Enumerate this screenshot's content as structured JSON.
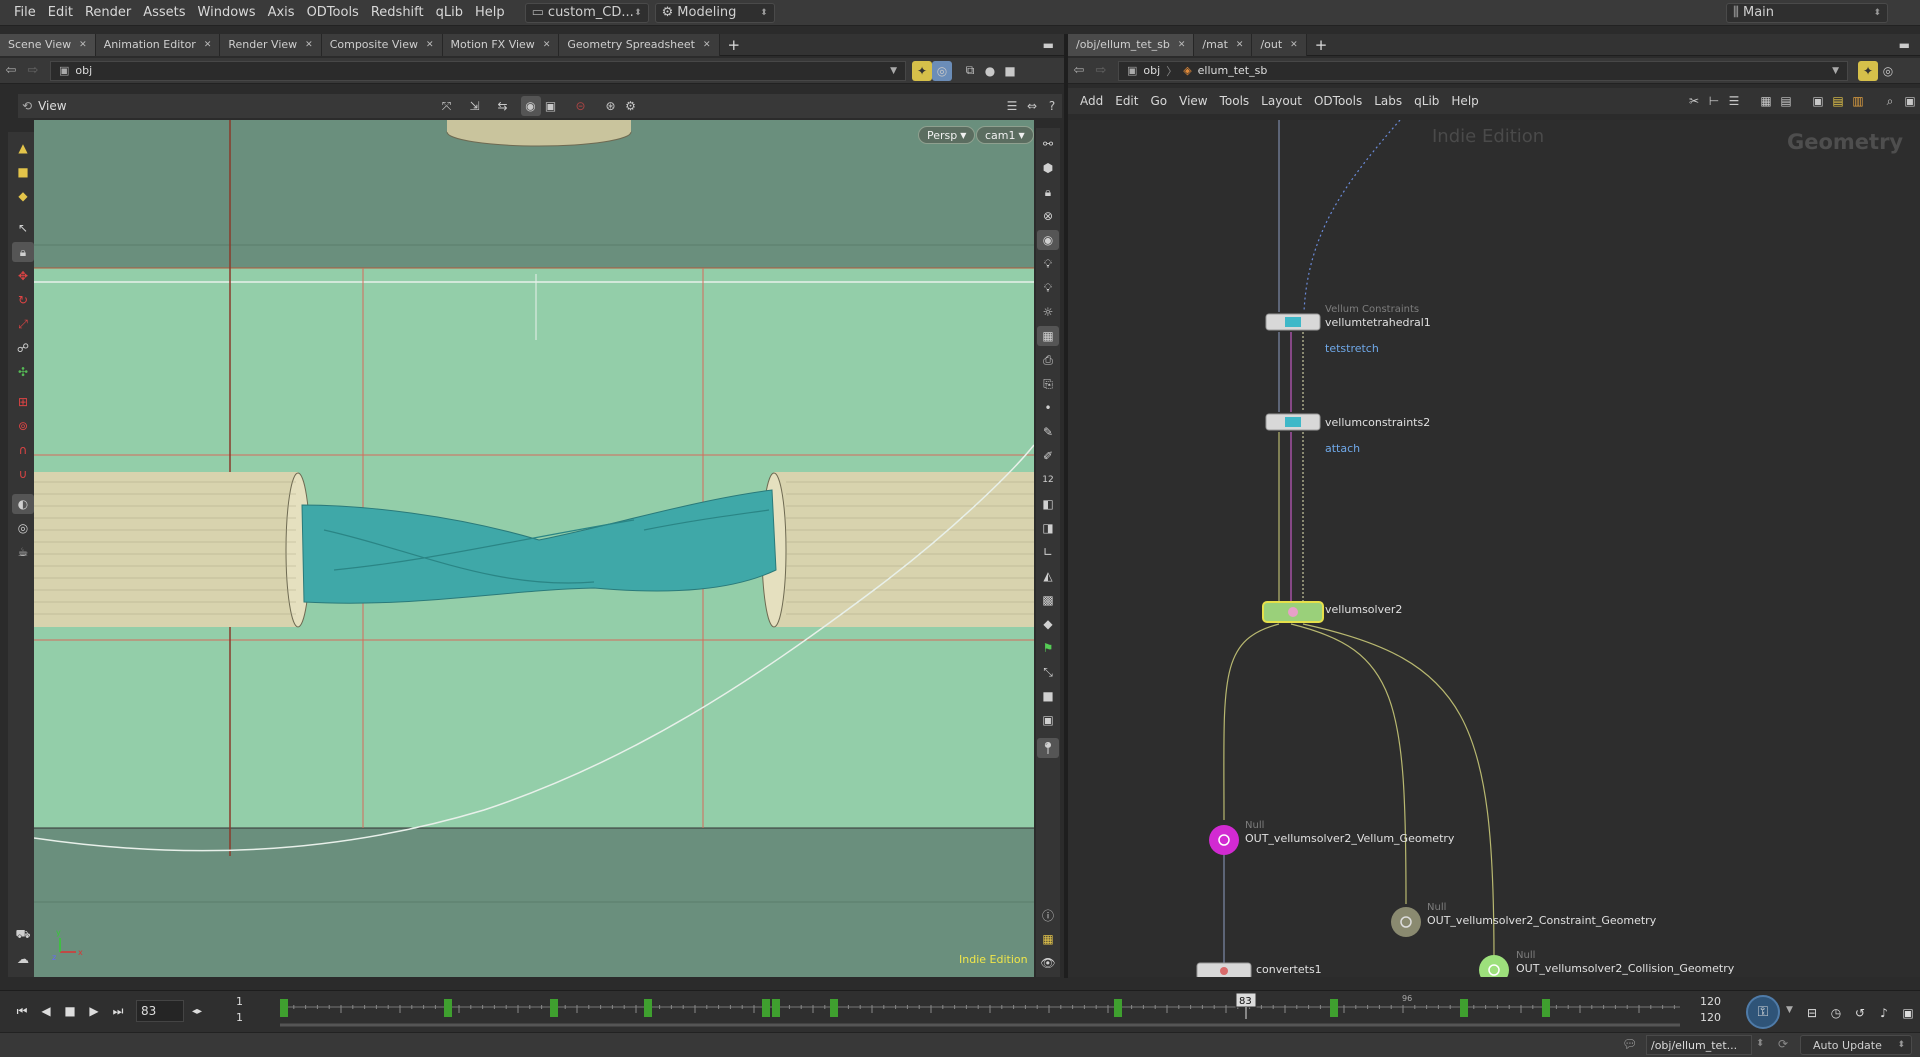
{
  "menubar": {
    "items": [
      "File",
      "Edit",
      "Render",
      "Assets",
      "Windows",
      "Axis",
      "ODTools",
      "Redshift",
      "qLib",
      "Help"
    ],
    "desktop_dropdown": "custom_CD...",
    "context_dropdown": "Modeling",
    "main_dropdown": "Main"
  },
  "left_pane": {
    "tabs": [
      "Scene View",
      "Animation Editor",
      "Render View",
      "Composite View",
      "Motion FX View",
      "Geometry Spreadsheet"
    ],
    "path": "obj",
    "view_label": "View",
    "camera_persp": "Persp",
    "camera_cam": "cam1",
    "edition_watermark": "Indie Edition"
  },
  "right_pane": {
    "tabs": [
      "/obj/ellum_tet_sb",
      "/mat",
      "/out"
    ],
    "path_root": "obj",
    "path_node": "ellum_tet_sb",
    "menu": [
      "Add",
      "Edit",
      "Go",
      "View",
      "Tools",
      "Layout",
      "ODTools",
      "Labs",
      "qLib",
      "Help"
    ],
    "watermark": "Indie Edition",
    "context_label": "Geometry",
    "nodes": {
      "tet": {
        "type": "Vellum Constraints",
        "name": "vellumtetrahedral1",
        "comment": "tetstretch"
      },
      "cons": {
        "name": "vellumconstraints2",
        "comment": "attach"
      },
      "solver": {
        "name": "vellumsolver2"
      },
      "out_vellum": {
        "type": "Null",
        "name": "OUT_vellumsolver2_Vellum_Geometry"
      },
      "out_constraint": {
        "type": "Null",
        "name": "OUT_vellumsolver2_Constraint_Geometry"
      },
      "out_collision": {
        "type": "Null",
        "name": "OUT_vellumsolver2_Collision_Geometry"
      },
      "convert": {
        "name": "convertets1"
      }
    }
  },
  "timeline": {
    "current_frame": "83",
    "start_frame": "1",
    "start_frame2": "1",
    "end_frame": "120",
    "end_frame2": "120",
    "playhead_label": "83",
    "mid_tick_label": "96"
  },
  "statusbar": {
    "path": "/obj/ellum_tet...",
    "update_mode": "Auto Update"
  },
  "colors": {
    "viewport_bg": "#6a8f7d",
    "camera_frame": "#93cea9",
    "cloth": "#3fa8a8",
    "cylinder": "#d8d3ae",
    "null_magenta": "#d22ad2",
    "null_green": "#9de07c",
    "solver_yellow": "#e6e04a"
  }
}
